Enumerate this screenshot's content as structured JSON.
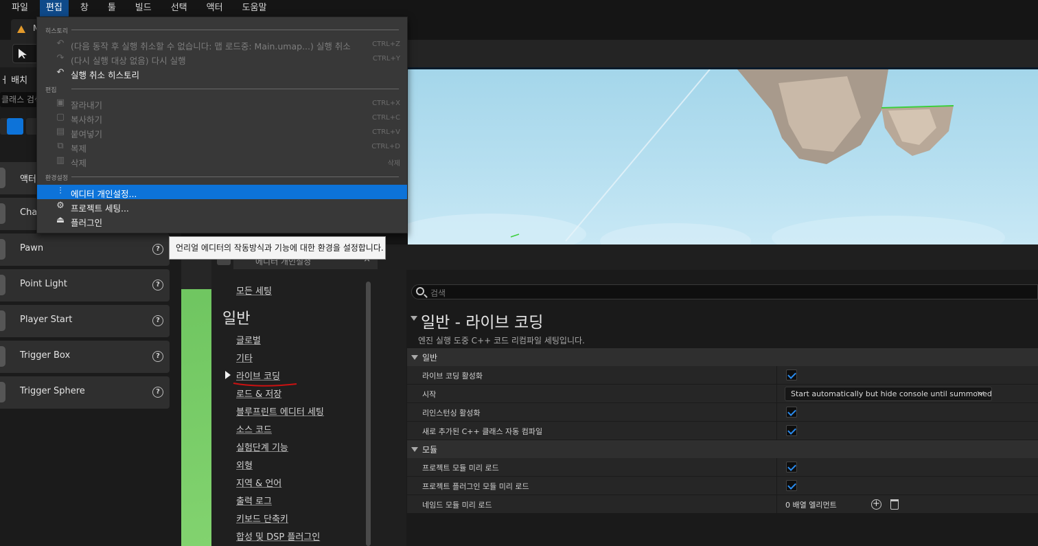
{
  "menubar": [
    "파일",
    "편집",
    "창",
    "툴",
    "빌드",
    "선택",
    "액터",
    "도움말"
  ],
  "level_tab": "M",
  "left_panel": {
    "title": "배치",
    "title_prefix_cut": "ㅓ",
    "search_placeholder": "클래스 검색",
    "actors": [
      "액터",
      "Char",
      "Pawn",
      "Point Light",
      "Player Start",
      "Trigger Box",
      "Trigger Sphere"
    ]
  },
  "edit_menu": {
    "sections": [
      "히스토리",
      "편집",
      "환경설정"
    ],
    "items": [
      {
        "label": "(다음 동작 후 실행 취소할 수 없습니다: 맵 로드중: Main.umap...) 실행 취소",
        "shortcut": "CTRL+Z",
        "icon": "undo-icon",
        "glyph": "↶",
        "state": "disabled"
      },
      {
        "label": "(다시 실행 대상 없음) 다시 실행",
        "shortcut": "CTRL+Y",
        "icon": "redo-icon",
        "glyph": "↷",
        "state": "disabled"
      },
      {
        "label": "실행 취소 히스토리",
        "shortcut": "",
        "icon": "undo-history-icon",
        "glyph": "↶",
        "state": "enabled"
      },
      {
        "label": "잘라내기",
        "shortcut": "CTRL+X",
        "icon": "cut-icon",
        "glyph": "▣",
        "state": "disabled"
      },
      {
        "label": "복사하기",
        "shortcut": "CTRL+C",
        "icon": "copy-icon",
        "glyph": "▢",
        "state": "disabled"
      },
      {
        "label": "붙여넣기",
        "shortcut": "CTRL+V",
        "icon": "paste-icon",
        "glyph": "▤",
        "state": "disabled"
      },
      {
        "label": "복제",
        "shortcut": "CTRL+D",
        "icon": "duplicate-icon",
        "glyph": "⧉",
        "state": "disabled"
      },
      {
        "label": "삭제",
        "shortcut": "삭제",
        "icon": "delete-icon",
        "glyph": "▥",
        "state": "disabled"
      },
      {
        "label": "에디터 개인설정...",
        "shortcut": "",
        "icon": "sliders-icon",
        "glyph": "⫶",
        "state": "selected"
      },
      {
        "label": "프로젝트 세팅...",
        "shortcut": "",
        "icon": "project-settings-icon",
        "glyph": "⚙",
        "state": "enabled"
      },
      {
        "label": "플러그인",
        "shortcut": "",
        "icon": "plugin-icon",
        "glyph": "⏏",
        "state": "enabled"
      }
    ]
  },
  "tooltip": "언리얼 에디터의 작동방식과 기능에 대한 환경을 설정합니다.",
  "preferences": {
    "tab_title": "에디터 개인설정",
    "close": "×",
    "all_settings": "모든 세팅",
    "group_title": "일반",
    "nav_items": [
      "글로벌",
      "기타",
      "라이브 코딩",
      "로드 & 저장",
      "블루프린트 에디터 세팅",
      "소스 코드",
      "실험단계 기능",
      "외형",
      "지역 & 언어",
      "출력 로그",
      "키보드 단축키",
      "합성 및 DSP 플러그인"
    ],
    "search_placeholder": "검색",
    "details_title": "일반 - 라이브 코딩",
    "details_desc": "엔진 실행 도중 C++ 코드 리컴파일 세팅입니다.",
    "categories": [
      {
        "name": "일반",
        "rows": [
          {
            "label": "라이브 코딩 활성화",
            "type": "checkbox",
            "checked": true
          },
          {
            "label": "시작",
            "type": "combo",
            "value": "Start automatically but hide console until summoned"
          },
          {
            "label": "리인스턴싱 활성화",
            "type": "checkbox",
            "checked": true
          },
          {
            "label": "새로 추가된 C++ 클래스 자동 컴파일",
            "type": "checkbox",
            "checked": true
          }
        ]
      },
      {
        "name": "모듈",
        "rows": [
          {
            "label": "프로젝트 모듈 미리 로드",
            "type": "checkbox",
            "checked": true
          },
          {
            "label": "프로젝트 플러그인 모듈 미리 로드",
            "type": "checkbox",
            "checked": true
          },
          {
            "label": "네임드 모듈 미리 로드",
            "type": "array",
            "value": "0 배열 엘리먼트"
          }
        ]
      }
    ]
  },
  "colors": {
    "accent": "#0d73d9",
    "check": "#2a8cf0",
    "annotation": "#cc1111"
  }
}
